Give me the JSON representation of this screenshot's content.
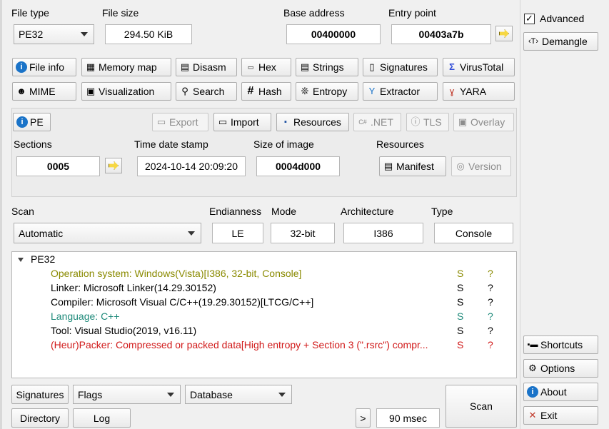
{
  "top": {
    "file_type_label": "File type",
    "file_type_value": "PE32",
    "file_size_label": "File size",
    "file_size_value": "294.50 KiB",
    "base_address_label": "Base address",
    "base_address_value": "00400000",
    "entry_point_label": "Entry point",
    "entry_point_value": "00403a7b"
  },
  "right_panel": {
    "advanced_label": "Advanced",
    "advanced_checked": true,
    "demangle_label": "Demangle",
    "shortcuts_label": "Shortcuts",
    "options_label": "Options",
    "about_label": "About",
    "exit_label": "Exit"
  },
  "tools_row1": [
    "File info",
    "Memory map",
    "Disasm",
    "Hex",
    "Strings",
    "Signatures",
    "VirusTotal"
  ],
  "tools_row2": [
    "MIME",
    "Visualization",
    "Search",
    "Hash",
    "Entropy",
    "Extractor",
    "YARA"
  ],
  "pe": {
    "pe_button": "PE",
    "export": "Export",
    "import": "Import",
    "resources": "Resources",
    "net": ".NET",
    "tls": "TLS",
    "overlay": "Overlay",
    "sections_label": "Sections",
    "sections_value": "0005",
    "time_label": "Time date stamp",
    "time_value": "2024-10-14 20:09:20",
    "size_label": "Size of image",
    "size_value": "0004d000",
    "resources_label": "Resources",
    "manifest": "Manifest",
    "version": "Version"
  },
  "scan": {
    "scan_label": "Scan",
    "scan_value": "Automatic",
    "endianness_label": "Endianness",
    "endianness_value": "LE",
    "mode_label": "Mode",
    "mode_value": "32-bit",
    "arch_label": "Architecture",
    "arch_value": "I386",
    "type_label": "Type",
    "type_value": "Console"
  },
  "results": {
    "root": "PE32",
    "rows": [
      {
        "text": "Operation system: Windows(Vista)[I386, 32-bit, Console]",
        "s": "S",
        "q": "?",
        "color": "olive"
      },
      {
        "text": "Linker: Microsoft Linker(14.29.30152)",
        "s": "S",
        "q": "?",
        "color": "blk"
      },
      {
        "text": "Compiler: Microsoft Visual C/C++(19.29.30152)[LTCG/C++]",
        "s": "S",
        "q": "?",
        "color": "blk"
      },
      {
        "text": "Language: C++",
        "s": "S",
        "q": "?",
        "color": "teal"
      },
      {
        "text": "Tool: Visual Studio(2019, v16.11)",
        "s": "S",
        "q": "?",
        "color": "blk"
      },
      {
        "text": "(Heur)Packer: Compressed or packed data[High entropy + Section 3 (\".rsrc\") compr...",
        "s": "S",
        "q": "?",
        "color": "red"
      }
    ]
  },
  "bottom": {
    "signatures": "Signatures",
    "flags": "Flags",
    "database": "Database",
    "directory": "Directory",
    "log": "Log",
    "more": ">",
    "time": "90 msec",
    "scan": "Scan"
  },
  "colors": {
    "olive": "#8a8a00",
    "teal": "#1e8a7a",
    "red": "#d11a1a",
    "accent": "#1a73c8"
  }
}
